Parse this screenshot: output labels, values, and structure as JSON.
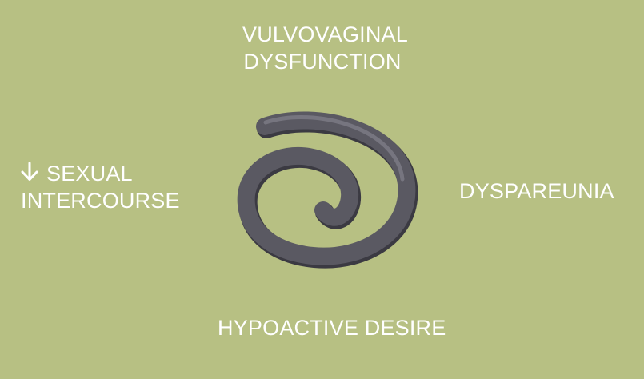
{
  "colors": {
    "background": "#b7c083",
    "label_text": "#ffffff",
    "spiral_stroke": "#5a5962",
    "spiral_highlight": "#807f8a",
    "spiral_shadow": "#3b3a42"
  },
  "labels": {
    "top": [
      "VULVOVAGINAL",
      "DYSFUNCTION"
    ],
    "left": {
      "icon": "arrow-down-icon",
      "lines": [
        "SEXUAL",
        "INTERCOURSE"
      ]
    },
    "right": "DYSPAREUNIA",
    "bottom": "HYPOACTIVE DESIRE"
  },
  "center_graphic": "spiral-icon"
}
